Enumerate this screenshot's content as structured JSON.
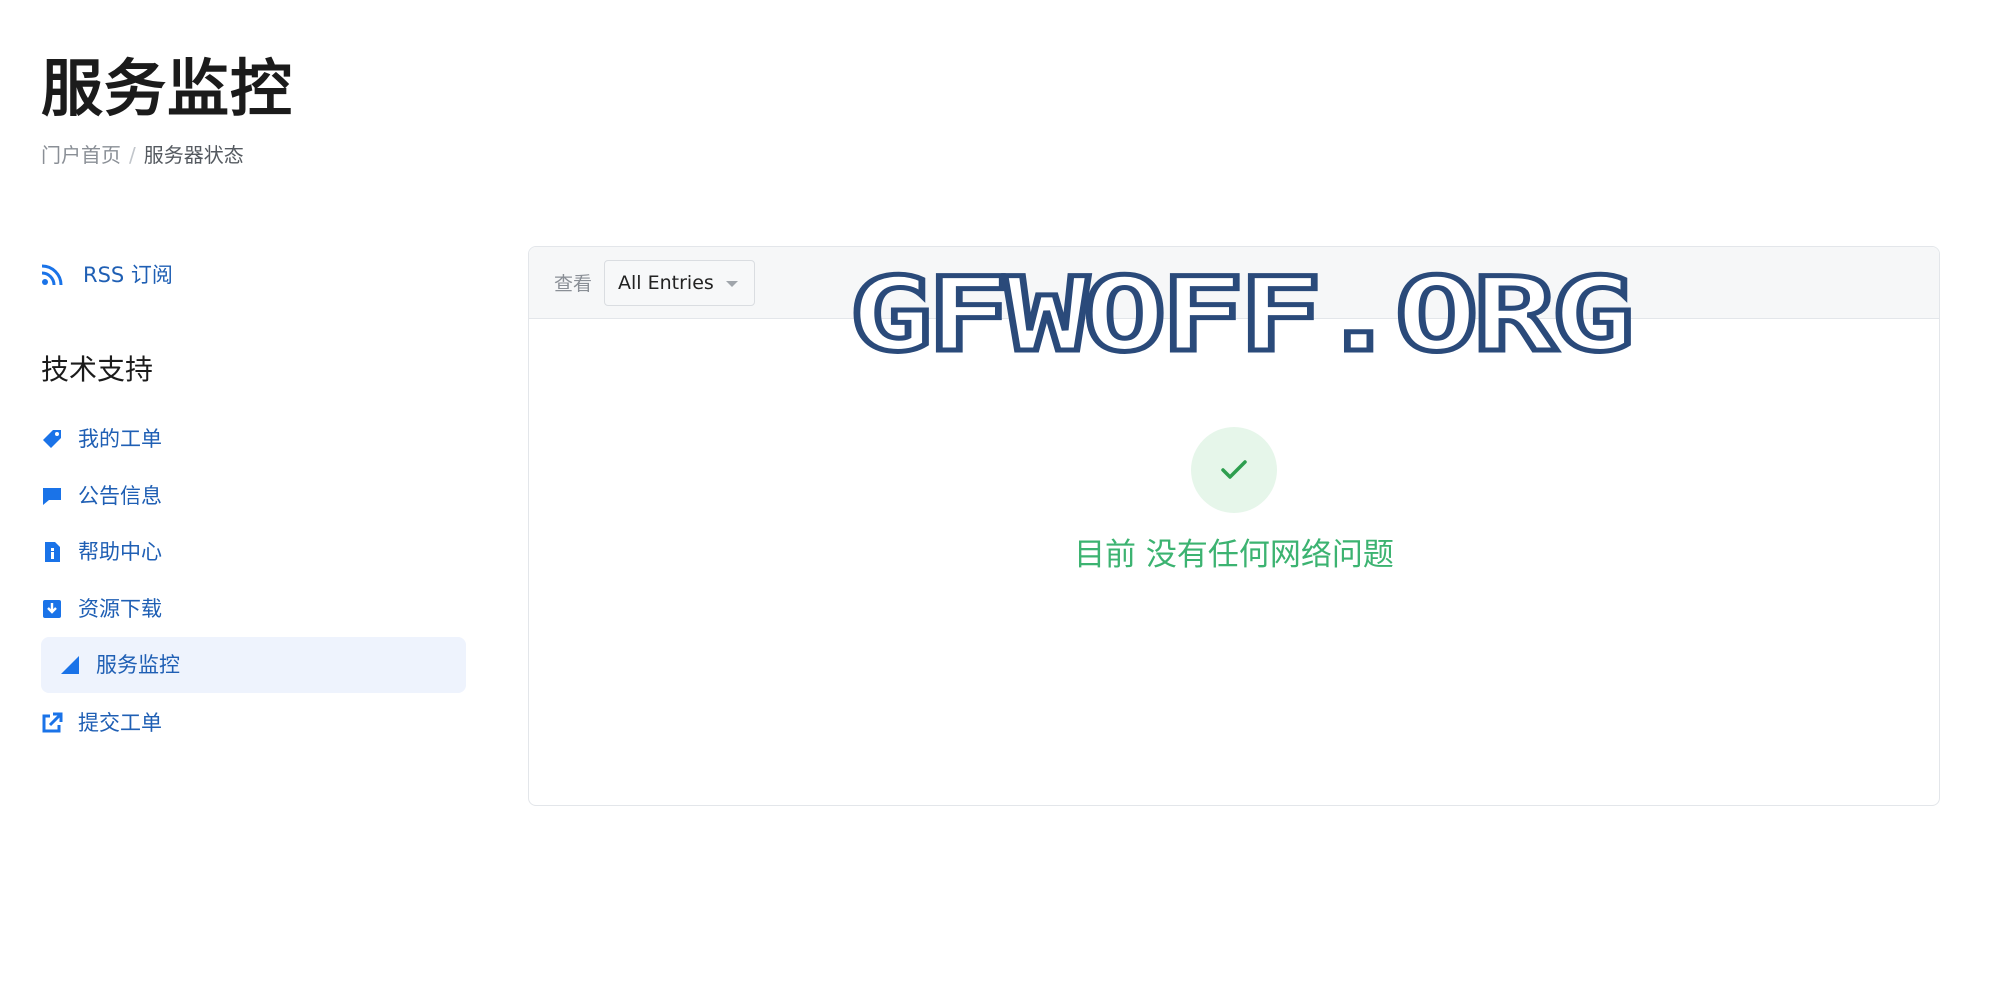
{
  "page": {
    "title": "服务监控"
  },
  "breadcrumb": {
    "home": "门户首页",
    "separator": "/",
    "current": "服务器状态"
  },
  "sidebar": {
    "rss_label": "RSS 订阅",
    "section_title": "技术支持",
    "items": [
      {
        "label": "我的工单",
        "icon": "tag-icon"
      },
      {
        "label": "公告信息",
        "icon": "comment-icon"
      },
      {
        "label": "帮助中心",
        "icon": "info-document-icon"
      },
      {
        "label": "资源下载",
        "icon": "download-icon"
      },
      {
        "label": "服务监控",
        "icon": "signal-triangle-icon",
        "active": true
      },
      {
        "label": "提交工单",
        "icon": "external-link-icon"
      }
    ]
  },
  "filter": {
    "label": "查看",
    "selected": "All Entries"
  },
  "status": {
    "message": "目前 没有任何网络问题",
    "icon": "check-icon"
  },
  "watermark": {
    "text": "GFWOFF.ORG"
  },
  "colors": {
    "link": "#1f5fb4",
    "icon_blue": "#1a73e8",
    "success": "#3cb371",
    "success_bg": "#e6f6ea",
    "active_bg": "#eef3fd",
    "watermark_stroke": "#2a4a7a"
  }
}
